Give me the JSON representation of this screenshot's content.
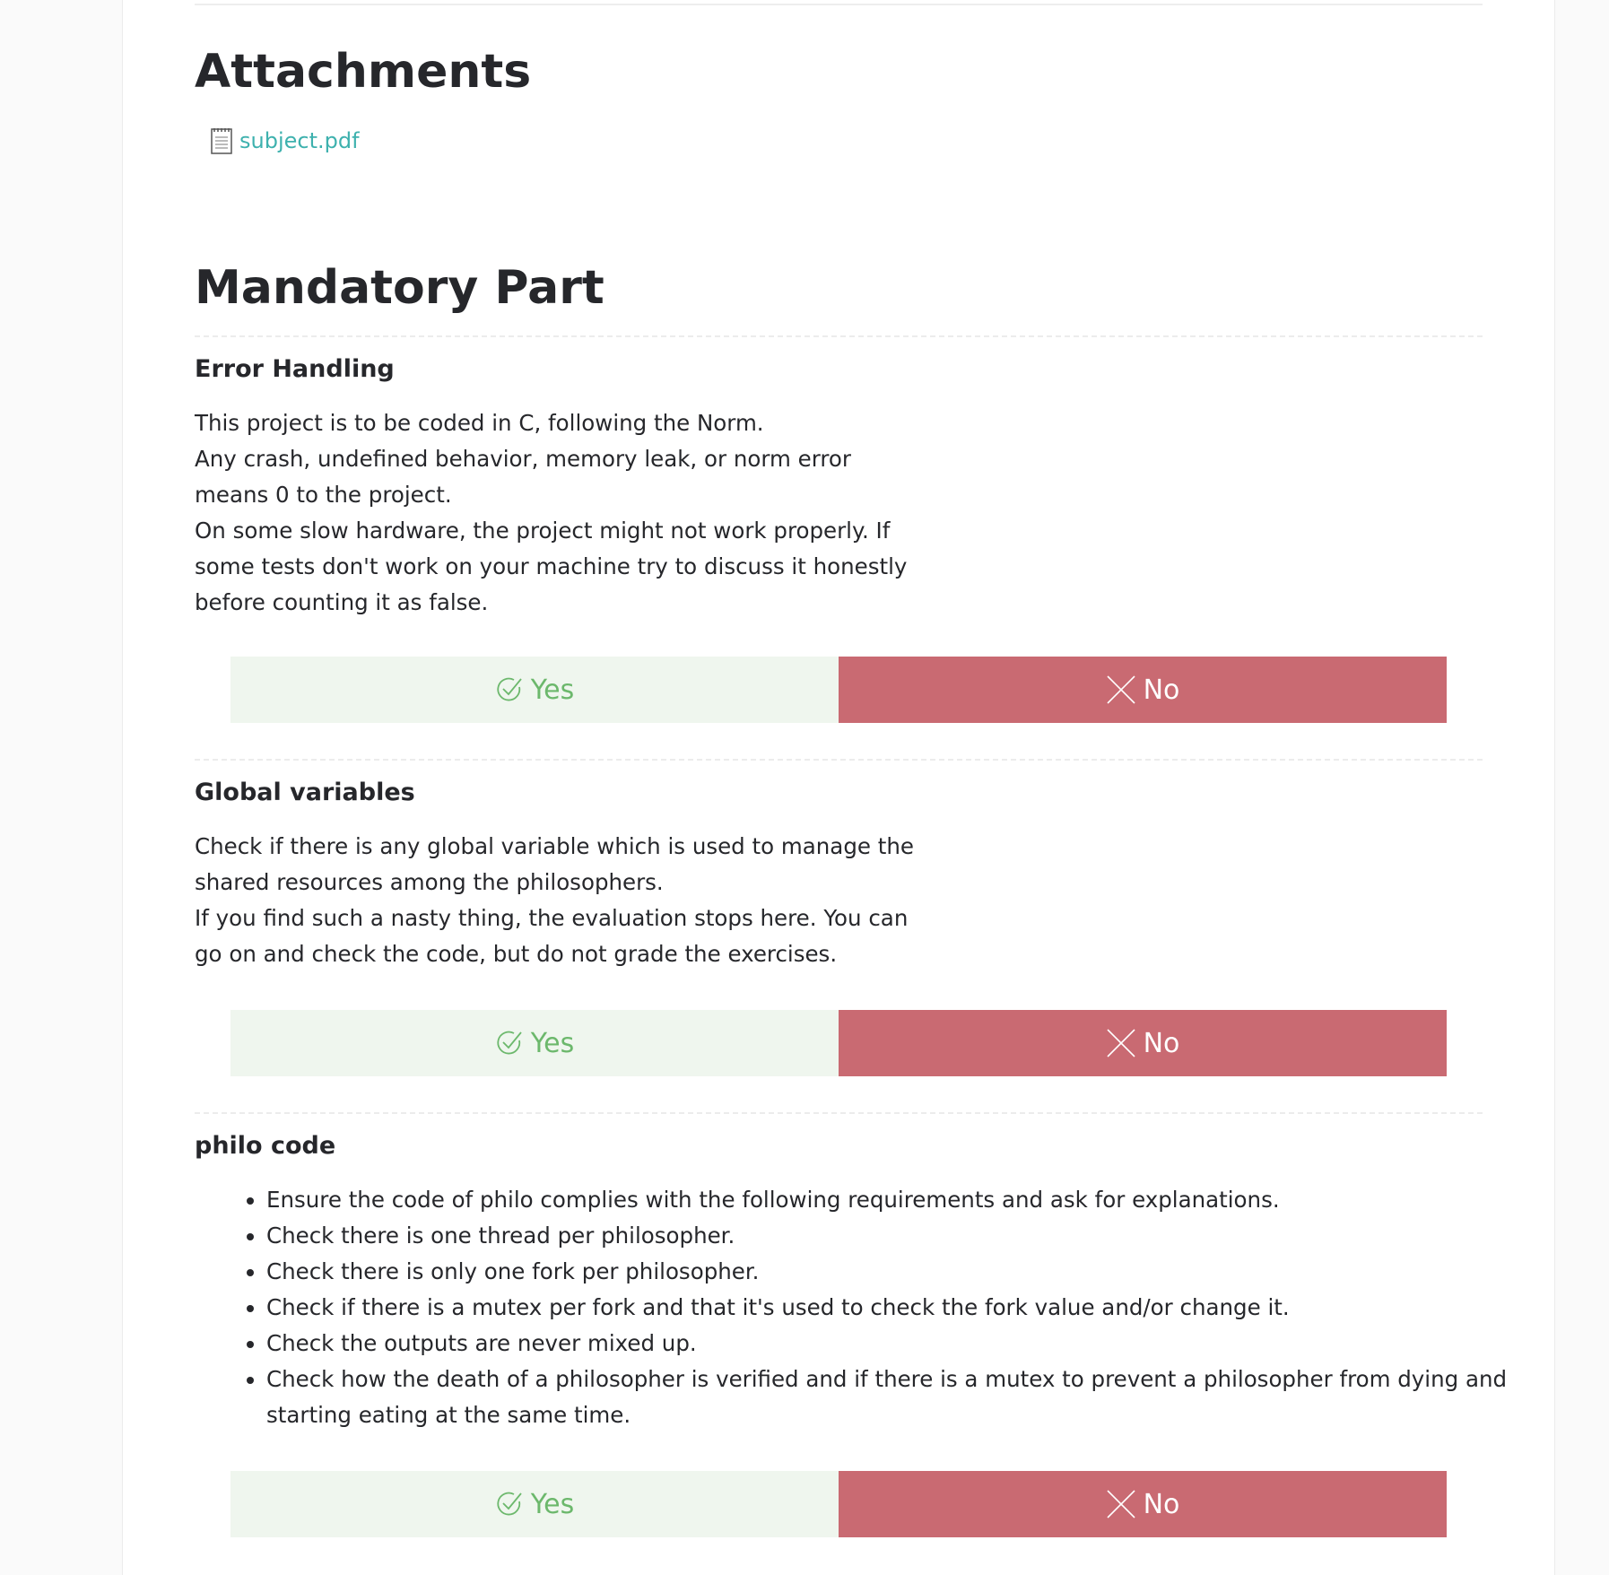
{
  "attachments": {
    "title": "Attachments",
    "file_icon": "document-icon",
    "file_name": "subject.pdf"
  },
  "mandatory": {
    "title": "Mandatory Part",
    "yes_label": "Yes",
    "no_label": "No",
    "colors": {
      "yes_bg": "#eff6ee",
      "yes_text": "#6cb86c",
      "no_bg": "#c96a72",
      "link": "#3eb1ae"
    },
    "sections": [
      {
        "title": "Error Handling",
        "lines": [
          "This project is to be coded in C, following the Norm.",
          "Any crash, undefined behavior, memory leak, or norm error means 0 to the project.",
          "On some slow hardware, the project might not work properly. If some tests don't work on your machine try to discuss it honestly before counting it as false."
        ]
      },
      {
        "title": "Global variables",
        "lines": [
          "Check if there is any global variable which is used to manage the shared resources among the philosophers.",
          "If you find such a nasty thing, the evaluation stops here. You can go on and check the code, but do not grade the exercises."
        ]
      },
      {
        "title": "philo code",
        "bullets": [
          "Ensure the code of philo complies with the following requirements and ask for explanations.",
          "Check there is one thread per philosopher.",
          "Check there is only one fork per philosopher.",
          "Check if there is a mutex per fork and that it's used to check the fork value and/or change it.",
          "Check the outputs are never mixed up.",
          "Check how the death of a philosopher is verified and if there is a mutex to prevent a philosopher from dying and starting eating at the same time."
        ]
      }
    ]
  }
}
